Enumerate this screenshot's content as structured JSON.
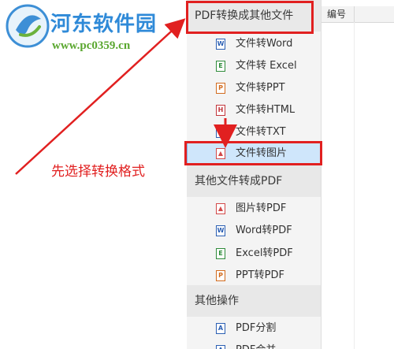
{
  "watermark": {
    "site_name": "河东软件园",
    "url": "www.pc0359.cn"
  },
  "sidebar": {
    "sections": [
      {
        "title": "PDF转换成其他文件",
        "highlighted": true,
        "items": [
          {
            "label": "文件转Word",
            "icon": "word-file-icon",
            "icon_letter": "W",
            "icon_color": "#2b5fb3"
          },
          {
            "label": "文件转 Excel",
            "icon": "excel-file-icon",
            "icon_letter": "E",
            "icon_color": "#2e8b3a"
          },
          {
            "label": "文件转PPT",
            "icon": "ppt-file-icon",
            "icon_letter": "P",
            "icon_color": "#d26b1e"
          },
          {
            "label": "文件转HTML",
            "icon": "html-file-icon",
            "icon_letter": "H",
            "icon_color": "#c2353b"
          },
          {
            "label": "文件转TXT",
            "icon": "txt-file-icon",
            "icon_letter": "T",
            "icon_color": "#2b5fb3"
          },
          {
            "label": "文件转图片",
            "icon": "image-file-icon",
            "icon_letter": "▲",
            "icon_color": "#d24848",
            "selected": true
          }
        ]
      },
      {
        "title": "其他文件转成PDF",
        "items": [
          {
            "label": "图片转PDF",
            "icon": "image-file-icon",
            "icon_letter": "▲",
            "icon_color": "#d24848"
          },
          {
            "label": "Word转PDF",
            "icon": "word-file-icon",
            "icon_letter": "W",
            "icon_color": "#2b5fb3"
          },
          {
            "label": "Excel转PDF",
            "icon": "excel-file-icon",
            "icon_letter": "E",
            "icon_color": "#2e8b3a"
          },
          {
            "label": "PPT转PDF",
            "icon": "ppt-file-icon",
            "icon_letter": "P",
            "icon_color": "#d26b1e"
          }
        ]
      },
      {
        "title": "其他操作",
        "items": [
          {
            "label": "PDF分割",
            "icon": "pdf-split-icon",
            "icon_letter": "A",
            "icon_color": "#2b5fb3"
          },
          {
            "label": "PDF合并",
            "icon": "pdf-merge-icon",
            "icon_letter": "A",
            "icon_color": "#2b5fb3"
          }
        ]
      }
    ]
  },
  "table": {
    "columns": [
      "编号"
    ]
  },
  "annotation": {
    "text": "先选择转换格式",
    "color": "#e12020"
  }
}
